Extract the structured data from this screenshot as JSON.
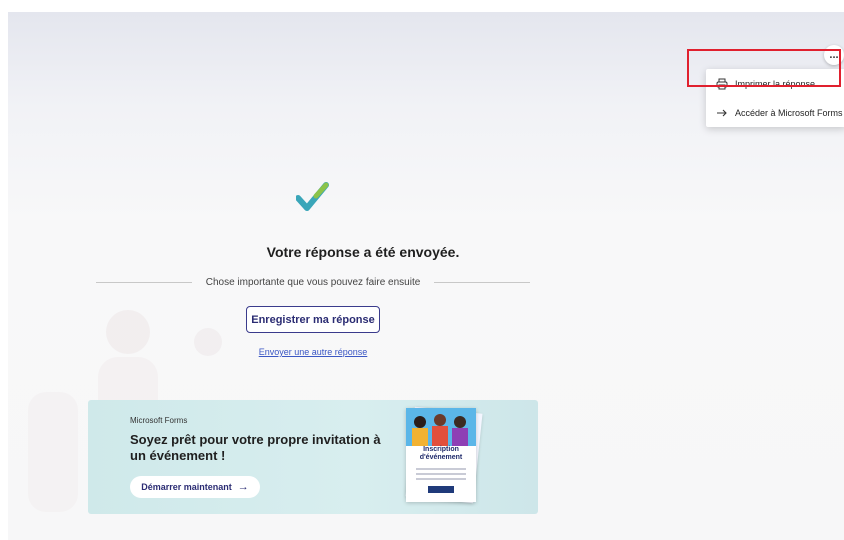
{
  "menu": {
    "more_label": "...",
    "items": [
      {
        "label": "Imprimer la réponse",
        "icon": "printer-icon"
      },
      {
        "label": "Accéder à Microsoft Forms",
        "icon": "arrow-right-icon"
      }
    ]
  },
  "confirmation": {
    "title": "Votre réponse a été envoyée.",
    "divider_text": "Chose importante que vous pouvez faire ensuite",
    "save_button": "Enregistrer ma réponse",
    "another_link": "Envoyer une autre réponse"
  },
  "promo": {
    "brand": "Microsoft Forms",
    "title": "Soyez prêt pour votre propre invitation à un événement !",
    "button": "Démarrer maintenant",
    "button_arrow": "→",
    "card_title": "Inscription d'événement"
  },
  "colors": {
    "accent": "#2b2c73",
    "link": "#3b57c4",
    "highlight": "#e0202e",
    "promo_bg": "#d8eeef"
  }
}
